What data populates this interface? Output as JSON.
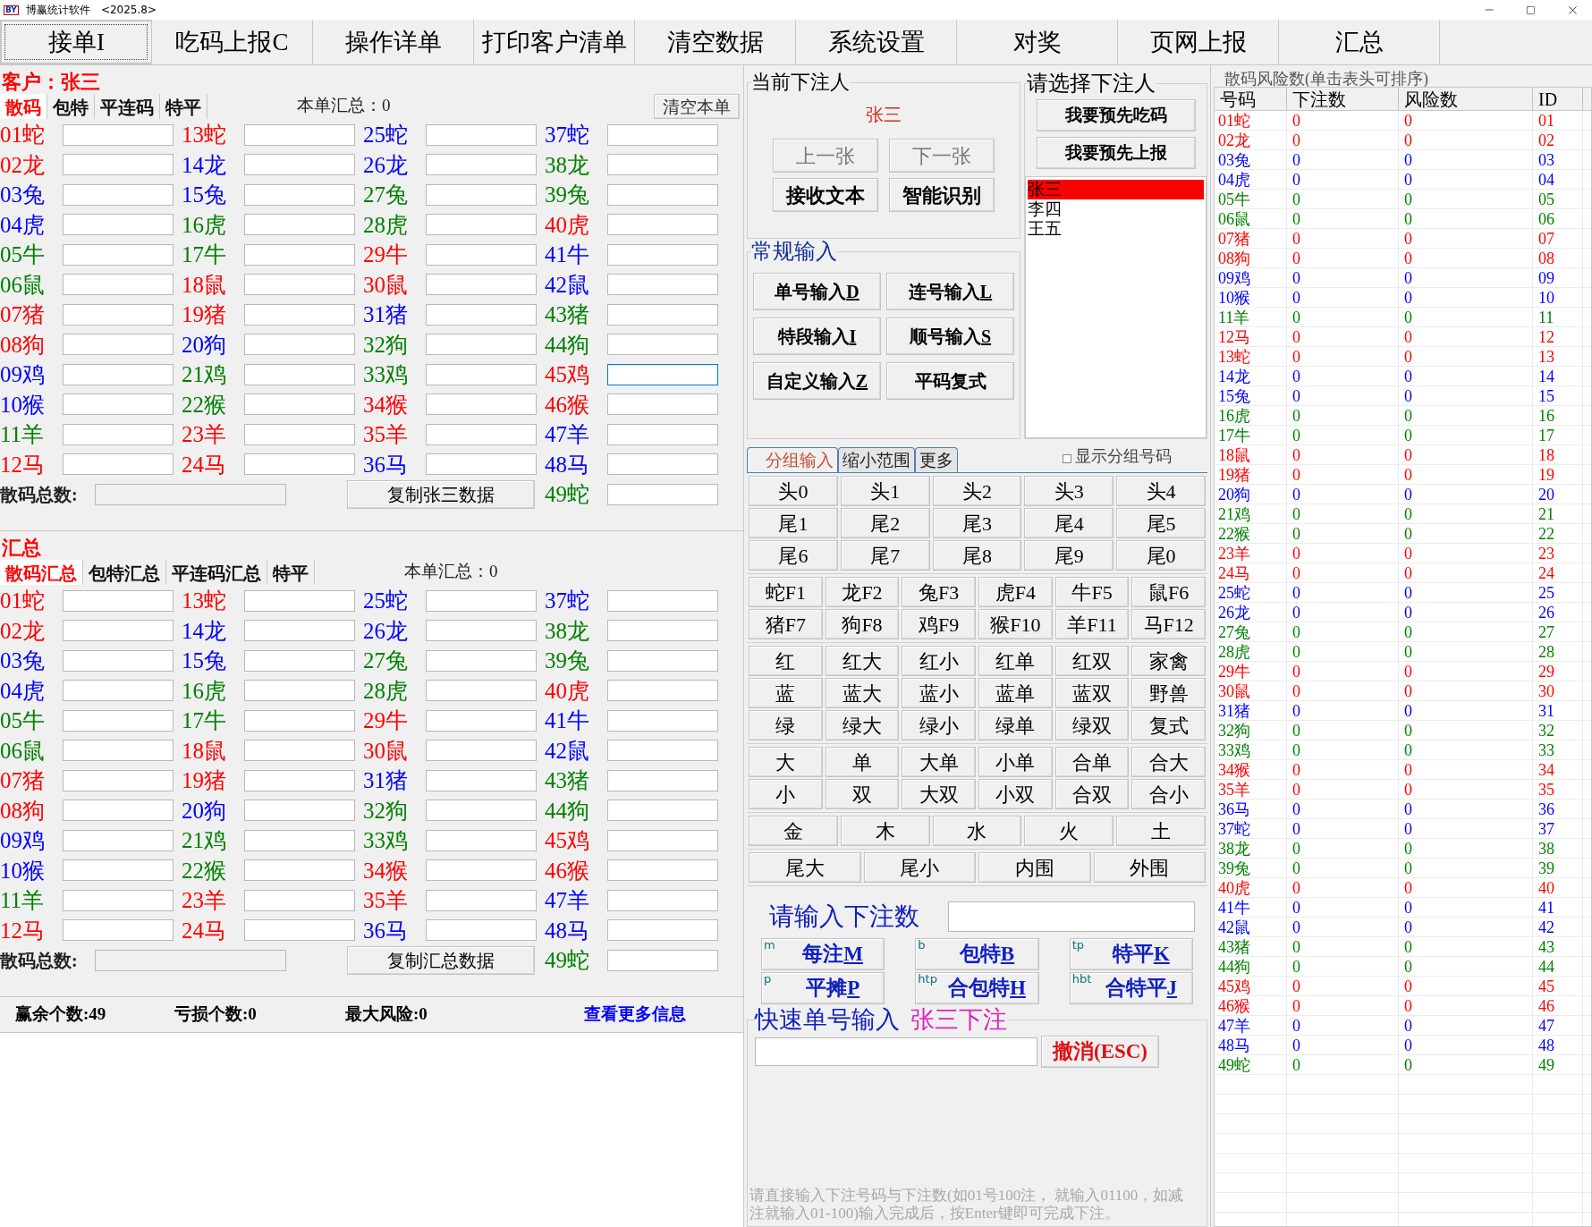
{
  "window": {
    "icon": "BY",
    "title": "博赢统计软件",
    "version": "<2025.8>"
  },
  "toolbar": [
    {
      "label": "接单I",
      "selected": true
    },
    {
      "label": "吃码上报C",
      "selected": false
    },
    {
      "label": "操作详单",
      "selected": false
    },
    {
      "label": "打印客户清单",
      "selected": false
    },
    {
      "label": "清空数据",
      "selected": false
    },
    {
      "label": "系统设置",
      "selected": false
    },
    {
      "label": "对奖",
      "selected": false
    },
    {
      "label": "页网上报",
      "selected": false
    },
    {
      "label": "汇总",
      "selected": false
    }
  ],
  "customer_panel": {
    "title": "客户：张三",
    "tabs": [
      {
        "label": "散码",
        "selected": true
      },
      {
        "label": "包特",
        "selected": false
      },
      {
        "label": "平连码",
        "selected": false
      },
      {
        "label": "特平",
        "selected": false
      }
    ],
    "total_label": "本单汇总：0",
    "clear_button": "清空本单",
    "count_label": "散码总数:",
    "copy_button": "复制张三数据",
    "numbers": [
      {
        "label": "01蛇",
        "color": "#ff0000",
        "focused": false
      },
      {
        "label": "02龙",
        "color": "#ff0000",
        "focused": false
      },
      {
        "label": "03兔",
        "color": "#0000ff",
        "focused": false
      },
      {
        "label": "04虎",
        "color": "#0000ff",
        "focused": false
      },
      {
        "label": "05牛",
        "color": "#008000",
        "focused": false
      },
      {
        "label": "06鼠",
        "color": "#008000",
        "focused": false
      },
      {
        "label": "07猪",
        "color": "#ff0000",
        "focused": false
      },
      {
        "label": "08狗",
        "color": "#ff0000",
        "focused": false
      },
      {
        "label": "09鸡",
        "color": "#0000ff",
        "focused": false
      },
      {
        "label": "10猴",
        "color": "#0000ff",
        "focused": false
      },
      {
        "label": "11羊",
        "color": "#008000",
        "focused": false
      },
      {
        "label": "12马",
        "color": "#ff0000",
        "focused": false
      },
      {
        "label": "13蛇",
        "color": "#ff0000",
        "focused": false
      },
      {
        "label": "14龙",
        "color": "#0000ff",
        "focused": false
      },
      {
        "label": "15兔",
        "color": "#0000ff",
        "focused": false
      },
      {
        "label": "16虎",
        "color": "#008000",
        "focused": false
      },
      {
        "label": "17牛",
        "color": "#008000",
        "focused": false
      },
      {
        "label": "18鼠",
        "color": "#ff0000",
        "focused": false
      },
      {
        "label": "19猪",
        "color": "#ff0000",
        "focused": false
      },
      {
        "label": "20狗",
        "color": "#0000ff",
        "focused": false
      },
      {
        "label": "21鸡",
        "color": "#008000",
        "focused": false
      },
      {
        "label": "22猴",
        "color": "#008000",
        "focused": false
      },
      {
        "label": "23羊",
        "color": "#ff0000",
        "focused": false
      },
      {
        "label": "24马",
        "color": "#ff0000",
        "focused": false
      },
      {
        "label": "25蛇",
        "color": "#0000ff",
        "focused": false
      },
      {
        "label": "26龙",
        "color": "#0000ff",
        "focused": false
      },
      {
        "label": "27兔",
        "color": "#008000",
        "focused": false
      },
      {
        "label": "28虎",
        "color": "#008000",
        "focused": false
      },
      {
        "label": "29牛",
        "color": "#ff0000",
        "focused": false
      },
      {
        "label": "30鼠",
        "color": "#ff0000",
        "focused": false
      },
      {
        "label": "31猪",
        "color": "#0000ff",
        "focused": false
      },
      {
        "label": "32狗",
        "color": "#008000",
        "focused": false
      },
      {
        "label": "33鸡",
        "color": "#008000",
        "focused": false
      },
      {
        "label": "34猴",
        "color": "#ff0000",
        "focused": false
      },
      {
        "label": "35羊",
        "color": "#ff0000",
        "focused": false
      },
      {
        "label": "36马",
        "color": "#0000ff",
        "focused": false
      },
      {
        "label": "37蛇",
        "color": "#0000ff",
        "focused": false
      },
      {
        "label": "38龙",
        "color": "#008000",
        "focused": false
      },
      {
        "label": "39兔",
        "color": "#008000",
        "focused": false
      },
      {
        "label": "40虎",
        "color": "#ff0000",
        "focused": false
      },
      {
        "label": "41牛",
        "color": "#0000ff",
        "focused": false
      },
      {
        "label": "42鼠",
        "color": "#0000ff",
        "focused": false
      },
      {
        "label": "43猪",
        "color": "#008000",
        "focused": false
      },
      {
        "label": "44狗",
        "color": "#008000",
        "focused": false
      },
      {
        "label": "45鸡",
        "color": "#ff0000",
        "focused": true
      },
      {
        "label": "46猴",
        "color": "#ff0000",
        "focused": false
      },
      {
        "label": "47羊",
        "color": "#0000ff",
        "focused": false
      },
      {
        "label": "48马",
        "color": "#0000ff",
        "focused": false
      },
      {
        "label": "49蛇",
        "color": "#008000",
        "focused": false
      }
    ]
  },
  "summary_panel": {
    "title": "汇总",
    "tabs": [
      {
        "label": "散码汇总",
        "selected": true
      },
      {
        "label": "包特汇总",
        "selected": false
      },
      {
        "label": "平连码汇总",
        "selected": false
      },
      {
        "label": "特平",
        "selected": false
      }
    ],
    "total_label": "本单汇总：0",
    "count_label": "散码总数:",
    "copy_button": "复制汇总数据",
    "numbers": [
      {
        "label": "01蛇",
        "color": "#ff0000"
      },
      {
        "label": "02龙",
        "color": "#ff0000"
      },
      {
        "label": "03兔",
        "color": "#0000ff"
      },
      {
        "label": "04虎",
        "color": "#0000ff"
      },
      {
        "label": "05牛",
        "color": "#008000"
      },
      {
        "label": "06鼠",
        "color": "#008000"
      },
      {
        "label": "07猪",
        "color": "#ff0000"
      },
      {
        "label": "08狗",
        "color": "#ff0000"
      },
      {
        "label": "09鸡",
        "color": "#0000ff"
      },
      {
        "label": "10猴",
        "color": "#0000ff"
      },
      {
        "label": "11羊",
        "color": "#008000"
      },
      {
        "label": "12马",
        "color": "#ff0000"
      },
      {
        "label": "13蛇",
        "color": "#ff0000"
      },
      {
        "label": "14龙",
        "color": "#0000ff"
      },
      {
        "label": "15兔",
        "color": "#0000ff"
      },
      {
        "label": "16虎",
        "color": "#008000"
      },
      {
        "label": "17牛",
        "color": "#008000"
      },
      {
        "label": "18鼠",
        "color": "#ff0000"
      },
      {
        "label": "19猪",
        "color": "#ff0000"
      },
      {
        "label": "20狗",
        "color": "#0000ff"
      },
      {
        "label": "21鸡",
        "color": "#008000"
      },
      {
        "label": "22猴",
        "color": "#008000"
      },
      {
        "label": "23羊",
        "color": "#ff0000"
      },
      {
        "label": "24马",
        "color": "#ff0000"
      },
      {
        "label": "25蛇",
        "color": "#0000ff"
      },
      {
        "label": "26龙",
        "color": "#0000ff"
      },
      {
        "label": "27兔",
        "color": "#008000"
      },
      {
        "label": "28虎",
        "color": "#008000"
      },
      {
        "label": "29牛",
        "color": "#ff0000"
      },
      {
        "label": "30鼠",
        "color": "#ff0000"
      },
      {
        "label": "31猪",
        "color": "#0000ff"
      },
      {
        "label": "32狗",
        "color": "#008000"
      },
      {
        "label": "33鸡",
        "color": "#008000"
      },
      {
        "label": "34猴",
        "color": "#ff0000"
      },
      {
        "label": "35羊",
        "color": "#ff0000"
      },
      {
        "label": "36马",
        "color": "#0000ff"
      },
      {
        "label": "37蛇",
        "color": "#0000ff"
      },
      {
        "label": "38龙",
        "color": "#008000"
      },
      {
        "label": "39兔",
        "color": "#008000"
      },
      {
        "label": "40虎",
        "color": "#ff0000"
      },
      {
        "label": "41牛",
        "color": "#0000ff"
      },
      {
        "label": "42鼠",
        "color": "#0000ff"
      },
      {
        "label": "43猪",
        "color": "#008000"
      },
      {
        "label": "44狗",
        "color": "#008000"
      },
      {
        "label": "45鸡",
        "color": "#ff0000"
      },
      {
        "label": "46猴",
        "color": "#ff0000"
      },
      {
        "label": "47羊",
        "color": "#0000ff"
      },
      {
        "label": "48马",
        "color": "#0000ff"
      },
      {
        "label": "49蛇",
        "color": "#008000"
      }
    ]
  },
  "status_bar": {
    "items": [
      "赢余个数:49",
      "亏损个数:0",
      "最大风险:0"
    ],
    "link": "查看更多信息"
  },
  "current_bettor": {
    "title": "当前下注人",
    "name": "张三",
    "buttons": [
      {
        "label": "上一张",
        "disabled": true
      },
      {
        "label": "下一张",
        "disabled": true
      },
      {
        "label": "接收文本",
        "disabled": false
      },
      {
        "label": "智能识别",
        "disabled": false
      }
    ]
  },
  "regular_input": {
    "title": "常规输入",
    "buttons": [
      {
        "label": "单号输入",
        "shortcut": "D"
      },
      {
        "label": "连号输入",
        "shortcut": "L"
      },
      {
        "label": "特段输入",
        "shortcut": "I"
      },
      {
        "label": "顺号输入",
        "shortcut": "S"
      },
      {
        "label": "自定义输入",
        "shortcut": "Z"
      },
      {
        "label": "平码复式"
      }
    ]
  },
  "bettor_select": {
    "title": "请选择下注人",
    "buttons": [
      "我要预先吃码",
      "我要预先上报"
    ],
    "list": [
      {
        "label": "张三",
        "selected": true
      },
      {
        "label": "李四",
        "selected": false
      },
      {
        "label": "王五",
        "selected": false
      }
    ]
  },
  "group_tabs": [
    {
      "label": "分组输入",
      "selected": true
    },
    {
      "label": "缩小范围",
      "selected": false
    },
    {
      "label": "更多",
      "selected": false
    }
  ],
  "show_group_numbers": {
    "label": "显示分组号码",
    "checked": false
  },
  "button_groups": [
    {
      "rows": [
        [
          "头0",
          "头1",
          "头2",
          "头3",
          "头4"
        ],
        [
          "尾1",
          "尾2",
          "尾3",
          "尾4",
          "尾5"
        ],
        [
          "尾6",
          "尾7",
          "尾8",
          "尾9",
          "尾0"
        ]
      ]
    },
    {
      "rows": [
        [
          "蛇F1",
          "龙F2",
          "兔F3",
          "虎F4",
          "牛F5",
          "鼠F6"
        ],
        [
          "猪F7",
          "狗F8",
          "鸡F9",
          "猴F10",
          "羊F11",
          "马F12"
        ]
      ]
    },
    {
      "rows": [
        [
          "红",
          "红大",
          "红小",
          "红单",
          "红双",
          "家禽"
        ],
        [
          "蓝",
          "蓝大",
          "蓝小",
          "蓝单",
          "蓝双",
          "野兽"
        ],
        [
          "绿",
          "绿大",
          "绿小",
          "绿单",
          "绿双",
          "复式"
        ]
      ]
    },
    {
      "rows": [
        [
          "大",
          "单",
          "大单",
          "小单",
          "合单",
          "合大"
        ],
        [
          "小",
          "双",
          "大双",
          "小双",
          "合双",
          "合小"
        ]
      ]
    },
    {
      "rows": [
        [
          "金",
          "木",
          "水",
          "火",
          "土"
        ]
      ]
    },
    {
      "rows": [
        [
          "尾大",
          "尾小",
          "内围",
          "外围"
        ]
      ]
    }
  ],
  "bet_entry": {
    "label": "请输入下注数",
    "buttons": [
      {
        "prefix": "m",
        "label": "每注",
        "shortcut": "M"
      },
      {
        "prefix": "b",
        "label": "包特",
        "shortcut": "B"
      },
      {
        "prefix": "tp",
        "label": "特平",
        "shortcut": "K"
      },
      {
        "prefix": "p",
        "label": "平摊",
        "shortcut": "P"
      },
      {
        "prefix": "htp",
        "label": "合包特",
        "shortcut": "H"
      },
      {
        "prefix": "hbt",
        "label": "合特平",
        "shortcut": "J"
      }
    ]
  },
  "quick_entry": {
    "title": "快速单号输入",
    "bettor": "张三下注",
    "cancel_button": "撤消(ESC)",
    "hint": "请直接输入下注号码与下注数(如01号100注， 就输入01100，如减注就输入01-100)输入完成后，按Enter键即可完成下注。"
  },
  "risk_table": {
    "title": "散码风险数(单击表头可排序)",
    "columns": [
      "号码",
      "下注数",
      "风险数",
      "ID"
    ],
    "rows": [
      {
        "code": "01蛇",
        "bets": "0",
        "risk": "0",
        "id": "01",
        "color": "#ff0000"
      },
      {
        "code": "02龙",
        "bets": "0",
        "risk": "0",
        "id": "02",
        "color": "#ff0000"
      },
      {
        "code": "03兔",
        "bets": "0",
        "risk": "0",
        "id": "03",
        "color": "#0000ff"
      },
      {
        "code": "04虎",
        "bets": "0",
        "risk": "0",
        "id": "04",
        "color": "#0000ff"
      },
      {
        "code": "05牛",
        "bets": "0",
        "risk": "0",
        "id": "05",
        "color": "#008000"
      },
      {
        "code": "06鼠",
        "bets": "0",
        "risk": "0",
        "id": "06",
        "color": "#008000"
      },
      {
        "code": "07猪",
        "bets": "0",
        "risk": "0",
        "id": "07",
        "color": "#ff0000"
      },
      {
        "code": "08狗",
        "bets": "0",
        "risk": "0",
        "id": "08",
        "color": "#ff0000"
      },
      {
        "code": "09鸡",
        "bets": "0",
        "risk": "0",
        "id": "09",
        "color": "#0000ff"
      },
      {
        "code": "10猴",
        "bets": "0",
        "risk": "0",
        "id": "10",
        "color": "#0000ff"
      },
      {
        "code": "11羊",
        "bets": "0",
        "risk": "0",
        "id": "11",
        "color": "#008000"
      },
      {
        "code": "12马",
        "bets": "0",
        "risk": "0",
        "id": "12",
        "color": "#ff0000"
      },
      {
        "code": "13蛇",
        "bets": "0",
        "risk": "0",
        "id": "13",
        "color": "#ff0000"
      },
      {
        "code": "14龙",
        "bets": "0",
        "risk": "0",
        "id": "14",
        "color": "#0000ff"
      },
      {
        "code": "15兔",
        "bets": "0",
        "risk": "0",
        "id": "15",
        "color": "#0000ff"
      },
      {
        "code": "16虎",
        "bets": "0",
        "risk": "0",
        "id": "16",
        "color": "#008000"
      },
      {
        "code": "17牛",
        "bets": "0",
        "risk": "0",
        "id": "17",
        "color": "#008000"
      },
      {
        "code": "18鼠",
        "bets": "0",
        "risk": "0",
        "id": "18",
        "color": "#ff0000"
      },
      {
        "code": "19猪",
        "bets": "0",
        "risk": "0",
        "id": "19",
        "color": "#ff0000"
      },
      {
        "code": "20狗",
        "bets": "0",
        "risk": "0",
        "id": "20",
        "color": "#0000ff"
      },
      {
        "code": "21鸡",
        "bets": "0",
        "risk": "0",
        "id": "21",
        "color": "#008000"
      },
      {
        "code": "22猴",
        "bets": "0",
        "risk": "0",
        "id": "22",
        "color": "#008000"
      },
      {
        "code": "23羊",
        "bets": "0",
        "risk": "0",
        "id": "23",
        "color": "#ff0000"
      },
      {
        "code": "24马",
        "bets": "0",
        "risk": "0",
        "id": "24",
        "color": "#ff0000"
      },
      {
        "code": "25蛇",
        "bets": "0",
        "risk": "0",
        "id": "25",
        "color": "#0000ff"
      },
      {
        "code": "26龙",
        "bets": "0",
        "risk": "0",
        "id": "26",
        "color": "#0000ff"
      },
      {
        "code": "27兔",
        "bets": "0",
        "risk": "0",
        "id": "27",
        "color": "#008000"
      },
      {
        "code": "28虎",
        "bets": "0",
        "risk": "0",
        "id": "28",
        "color": "#008000"
      },
      {
        "code": "29牛",
        "bets": "0",
        "risk": "0",
        "id": "29",
        "color": "#ff0000"
      },
      {
        "code": "30鼠",
        "bets": "0",
        "risk": "0",
        "id": "30",
        "color": "#ff0000"
      },
      {
        "code": "31猪",
        "bets": "0",
        "risk": "0",
        "id": "31",
        "color": "#0000ff"
      },
      {
        "code": "32狗",
        "bets": "0",
        "risk": "0",
        "id": "32",
        "color": "#008000"
      },
      {
        "code": "33鸡",
        "bets": "0",
        "risk": "0",
        "id": "33",
        "color": "#008000"
      },
      {
        "code": "34猴",
        "bets": "0",
        "risk": "0",
        "id": "34",
        "color": "#ff0000"
      },
      {
        "code": "35羊",
        "bets": "0",
        "risk": "0",
        "id": "35",
        "color": "#ff0000"
      },
      {
        "code": "36马",
        "bets": "0",
        "risk": "0",
        "id": "36",
        "color": "#0000ff"
      },
      {
        "code": "37蛇",
        "bets": "0",
        "risk": "0",
        "id": "37",
        "color": "#0000ff"
      },
      {
        "code": "38龙",
        "bets": "0",
        "risk": "0",
        "id": "38",
        "color": "#008000"
      },
      {
        "code": "39兔",
        "bets": "0",
        "risk": "0",
        "id": "39",
        "color": "#008000"
      },
      {
        "code": "40虎",
        "bets": "0",
        "risk": "0",
        "id": "40",
        "color": "#ff0000"
      },
      {
        "code": "41牛",
        "bets": "0",
        "risk": "0",
        "id": "41",
        "color": "#0000ff"
      },
      {
        "code": "42鼠",
        "bets": "0",
        "risk": "0",
        "id": "42",
        "color": "#0000ff"
      },
      {
        "code": "43猪",
        "bets": "0",
        "risk": "0",
        "id": "43",
        "color": "#008000"
      },
      {
        "code": "44狗",
        "bets": "0",
        "risk": "0",
        "id": "44",
        "color": "#008000"
      },
      {
        "code": "45鸡",
        "bets": "0",
        "risk": "0",
        "id": "45",
        "color": "#ff0000"
      },
      {
        "code": "46猴",
        "bets": "0",
        "risk": "0",
        "id": "46",
        "color": "#ff0000"
      },
      {
        "code": "47羊",
        "bets": "0",
        "risk": "0",
        "id": "47",
        "color": "#0000ff"
      },
      {
        "code": "48马",
        "bets": "0",
        "risk": "0",
        "id": "48",
        "color": "#0000ff"
      },
      {
        "code": "49蛇",
        "bets": "0",
        "risk": "0",
        "id": "49",
        "color": "#008000"
      }
    ]
  }
}
